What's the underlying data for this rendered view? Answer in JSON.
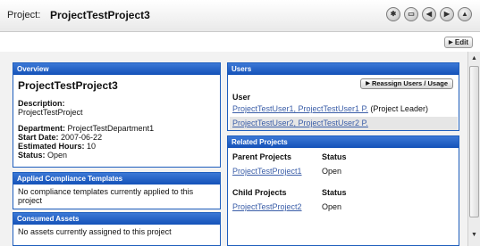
{
  "header": {
    "title_prefix": "Project:",
    "title_name": "ProjectTestProject3",
    "nav_icons": [
      "home-icon",
      "keyboard-icon",
      "back-icon",
      "forward-icon",
      "top-icon"
    ]
  },
  "toolbar": {
    "edit_label": "Edit"
  },
  "overview": {
    "heading": "Overview",
    "project_name": "ProjectTestProject3",
    "description_label": "Description:",
    "description_value": "ProjectTestProject",
    "department_label": "Department:",
    "department_value": "ProjectTestDepartment1",
    "start_label": "Start Date:",
    "start_value": "2007-06-22",
    "hours_label": "Estimated Hours:",
    "hours_value": "10",
    "status_label": "Status:",
    "status_value": "Open"
  },
  "compliance": {
    "heading": "Applied Compliance Templates",
    "message": "No compliance templates currently applied to this project"
  },
  "assets": {
    "heading": "Consumed Assets",
    "message": "No assets currently assigned to this project"
  },
  "users": {
    "heading": "Users",
    "reassign_label": "Reassign Users / Usage",
    "column_header": "User",
    "rows": [
      {
        "name": "ProjectTestUser1, ProjectTestUser1 P.",
        "role": "(Project Leader)"
      },
      {
        "name": "ProjectTestUser2, ProjectTestUser2 P.",
        "role": ""
      }
    ]
  },
  "related": {
    "heading": "Related Projects",
    "parent_header": "Parent Projects",
    "child_header": "Child Projects",
    "status_header": "Status",
    "parent": {
      "name": "ProjectTestProject1",
      "status": "Open"
    },
    "child": {
      "name": "ProjectTestProject2",
      "status": "Open"
    }
  },
  "colors": {
    "panel_header": "#1452b8",
    "link": "#3b5ea8"
  }
}
